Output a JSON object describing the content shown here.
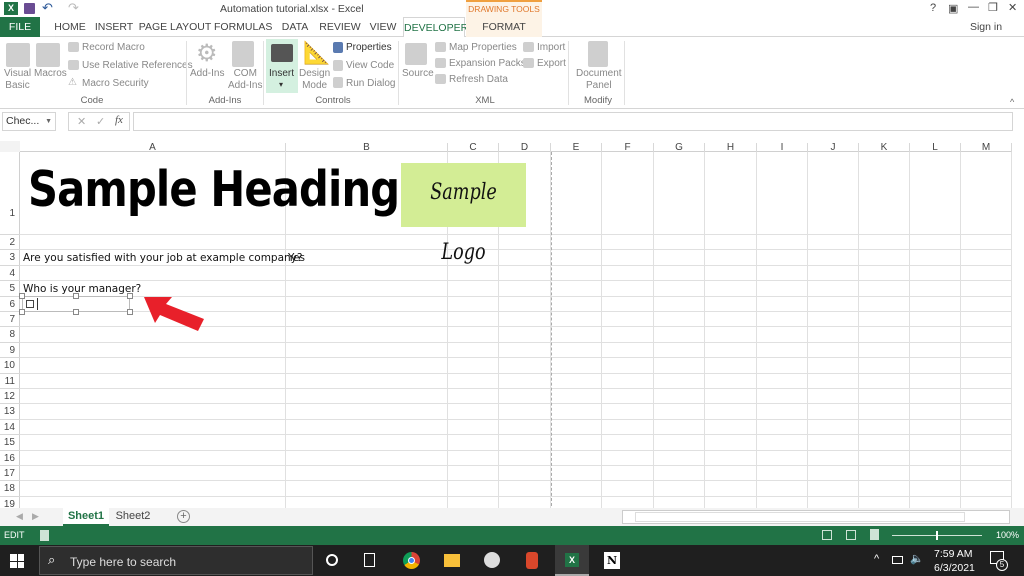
{
  "titlebar": {
    "title": "Automation tutorial.xlsx - Excel",
    "context_tab": "DRAWING TOOLS",
    "help": "?",
    "minimize": "—",
    "restore": "❐",
    "close": "✕",
    "sign_in": "Sign in",
    "accent": "#217346"
  },
  "tabs": [
    "FILE",
    "HOME",
    "INSERT",
    "PAGE LAYOUT",
    "FORMULAS",
    "DATA",
    "REVIEW",
    "VIEW",
    "DEVELOPER",
    "FORMAT"
  ],
  "ribbon": {
    "code": {
      "visual_basic": [
        "Visual",
        "Basic"
      ],
      "macros": "Macros",
      "record_macro": "Record Macro",
      "relative_refs": "Use Relative References",
      "macro_security": "Macro Security",
      "label": "Code"
    },
    "addins": {
      "addins": "Add-Ins",
      "com": [
        "COM",
        "Add-Ins"
      ],
      "label": "Add-Ins"
    },
    "controls": {
      "insert": "Insert",
      "insert_arrow": "▾",
      "design": [
        "Design",
        "Mode"
      ],
      "properties": "Properties",
      "view_code": "View Code",
      "run_dialog": "Run Dialog",
      "label": "Controls"
    },
    "xml": {
      "source": "Source",
      "map_properties": "Map Properties",
      "expansion_packs": "Expansion Packs",
      "refresh_data": "Refresh Data",
      "import": "Import",
      "export": "Export",
      "label": "XML"
    },
    "modify": {
      "document_panel": [
        "Document",
        "Panel"
      ],
      "label": "Modify"
    }
  },
  "formula_bar": {
    "name_box": "Chec...",
    "cancel": "✕",
    "enter": "✓",
    "fx": "fx",
    "value": ""
  },
  "columns": [
    "A",
    "B",
    "C",
    "D",
    "E",
    "F",
    "G",
    "H",
    "I",
    "J",
    "K",
    "L",
    "M"
  ],
  "rows": [
    "1",
    "2",
    "3",
    "4",
    "5",
    "6",
    "7",
    "8",
    "9",
    "10",
    "11",
    "12",
    "13",
    "14",
    "15",
    "16",
    "17",
    "18",
    "19"
  ],
  "cells": {
    "heading": "Sample Heading",
    "logo": "Sample Logo",
    "a3": "Are you satisfied with your job at example company?",
    "b3": "Yes",
    "a5": "Who is your manager?",
    "checkbox_text": ""
  },
  "sheets": {
    "tabs": [
      "Sheet1",
      "Sheet2"
    ],
    "active": "Sheet1",
    "add": "+"
  },
  "status": {
    "mode": "EDIT",
    "zoom": "100%"
  },
  "taskbar": {
    "search_placeholder": "Type here to search",
    "time": "7:59 AM",
    "date": "6/3/2021",
    "notifications": "5"
  }
}
